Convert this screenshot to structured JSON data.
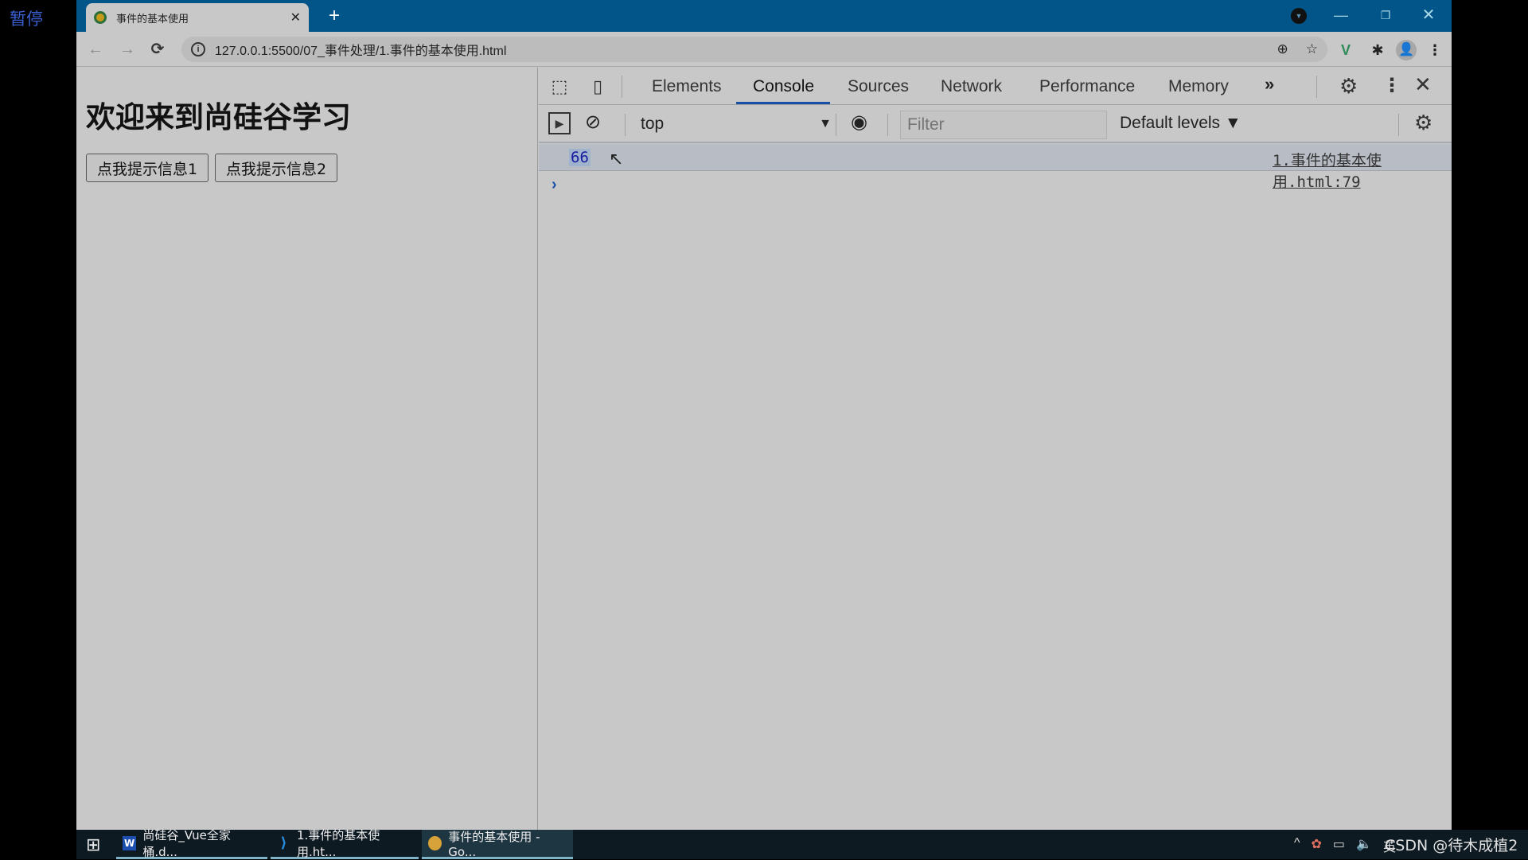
{
  "overlay": {
    "pause_label": "暂停",
    "watermark": "CSDN @待木成植2"
  },
  "browser": {
    "tab_title": "事件的基本使用",
    "tab_close": "✕",
    "new_tab": "+",
    "url": "127.0.0.1:5500/07_事件处理/1.事件的基本使用.html",
    "nav": {
      "back": "←",
      "forward": "→",
      "reload": "⟳"
    },
    "omnibox_tools": {
      "zoom": "⊕",
      "bookmark": "☆"
    },
    "extensions": {
      "vue": "V",
      "puzzle": "✱",
      "avatar": "👤",
      "menu": "⋮"
    },
    "window_controls": {
      "minimize": "—",
      "maximize": "❐",
      "close": "✕"
    }
  },
  "page": {
    "heading": "欢迎来到尚硅谷学习",
    "buttons": [
      "点我提示信息1",
      "点我提示信息2"
    ]
  },
  "devtools": {
    "tabs": [
      {
        "label": "Elements",
        "active": false
      },
      {
        "label": "Console",
        "active": true
      },
      {
        "label": "Sources",
        "active": false
      },
      {
        "label": "Network",
        "active": false
      },
      {
        "label": "Performance",
        "active": false
      },
      {
        "label": "Memory",
        "active": false
      }
    ],
    "more_tabs": "»",
    "context": "top",
    "filter_placeholder": "Filter",
    "levels": "Default levels ▼",
    "console": {
      "entries": [
        {
          "value": "66",
          "source": "1.事件的基本使用.html:79"
        }
      ],
      "prompt": "›"
    }
  },
  "taskbar": {
    "items": [
      {
        "icon": "W",
        "label": "尚硅谷_Vue全家桶.d..."
      },
      {
        "icon": "⟩",
        "label": "1.事件的基本使用.ht..."
      },
      {
        "icon": "",
        "label": "事件的基本使用 - Go..."
      }
    ],
    "tray": {
      "chevron": "^",
      "ime": "英"
    }
  }
}
